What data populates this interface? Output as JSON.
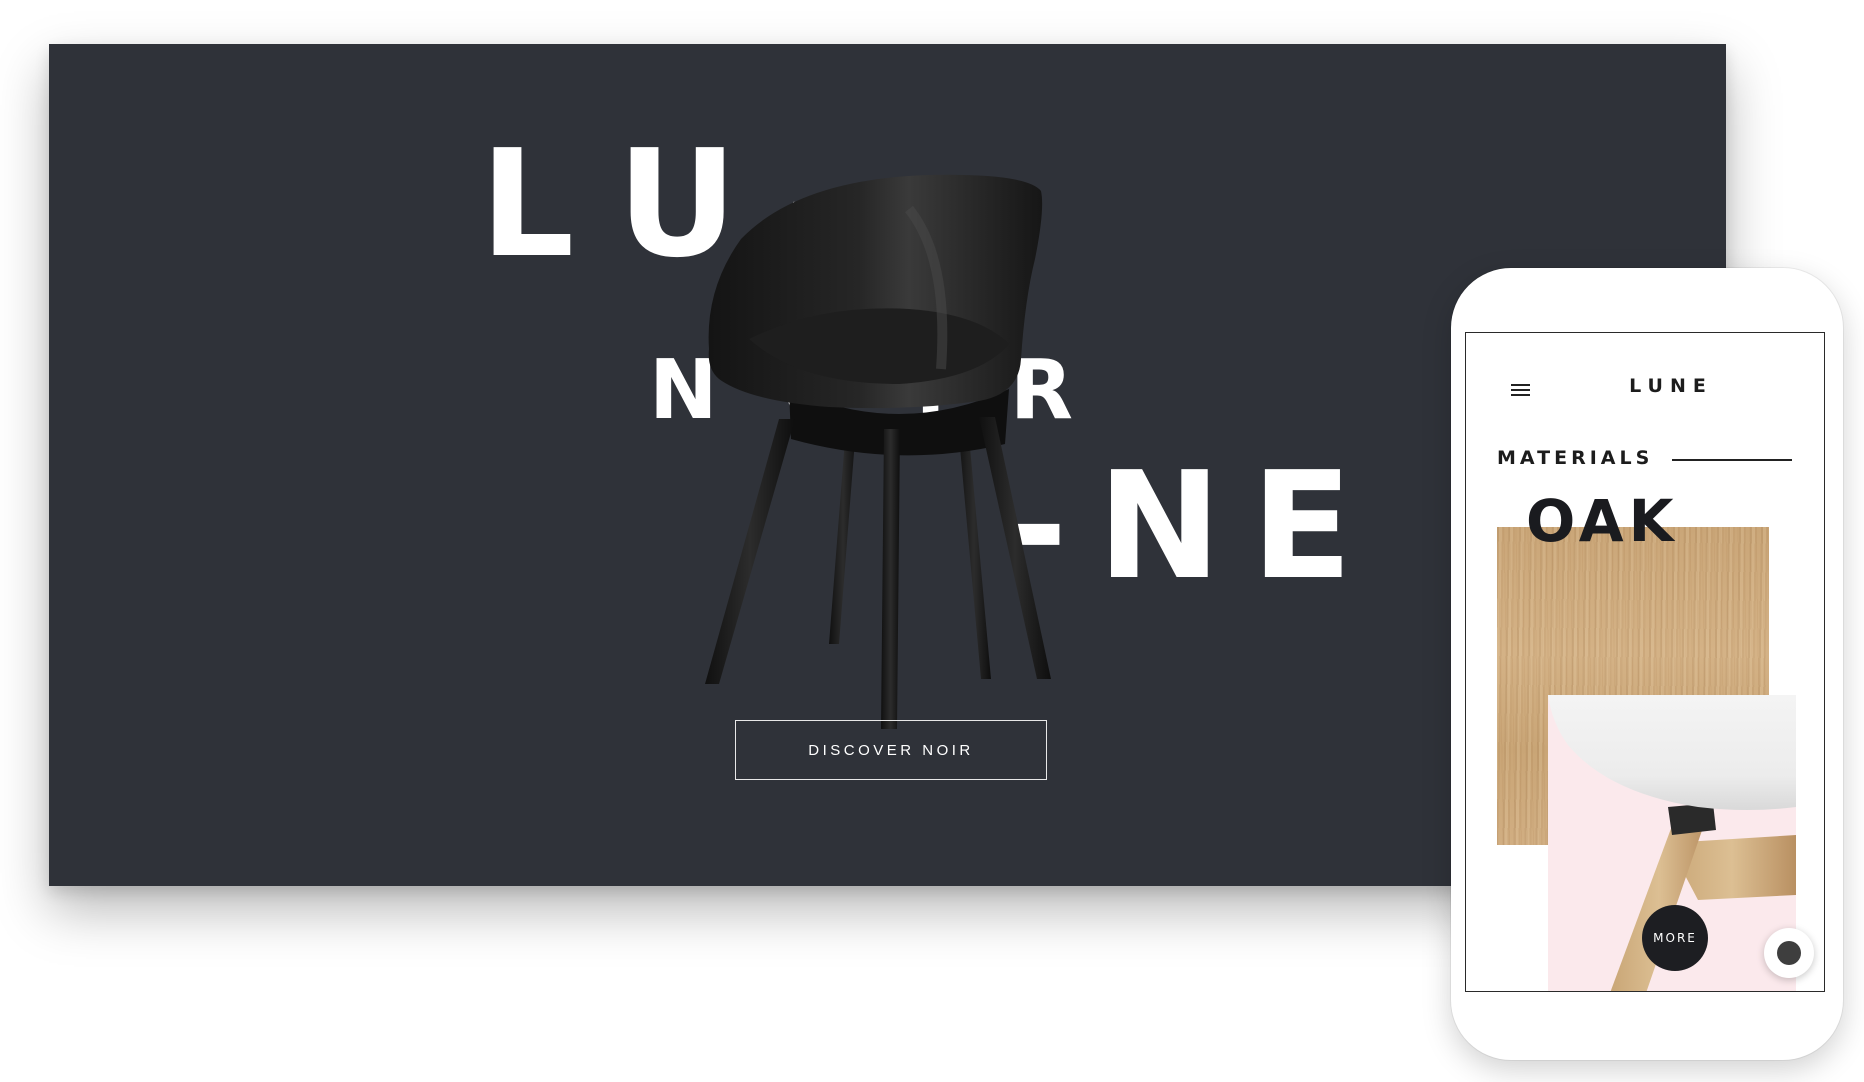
{
  "desktop": {
    "hero": {
      "line1": "LU-",
      "line2": "NOIR",
      "line3": "-NE"
    },
    "cta_label": "DISCOVER NOIR",
    "background_color": "#2f3239",
    "image": "black-chair"
  },
  "mobile": {
    "menu_icon": "hamburger-menu-icon",
    "logo": "LUNE",
    "section_label": "MATERIALS",
    "material_title": "OAK",
    "more_button_label": "MORE",
    "swatch": "oak-wood-texture",
    "product_image": "white-shell-chair-oak-legs",
    "product_bg_color": "#fbe9ec"
  },
  "floating_button": {
    "icon": "assistive-touch-icon"
  }
}
